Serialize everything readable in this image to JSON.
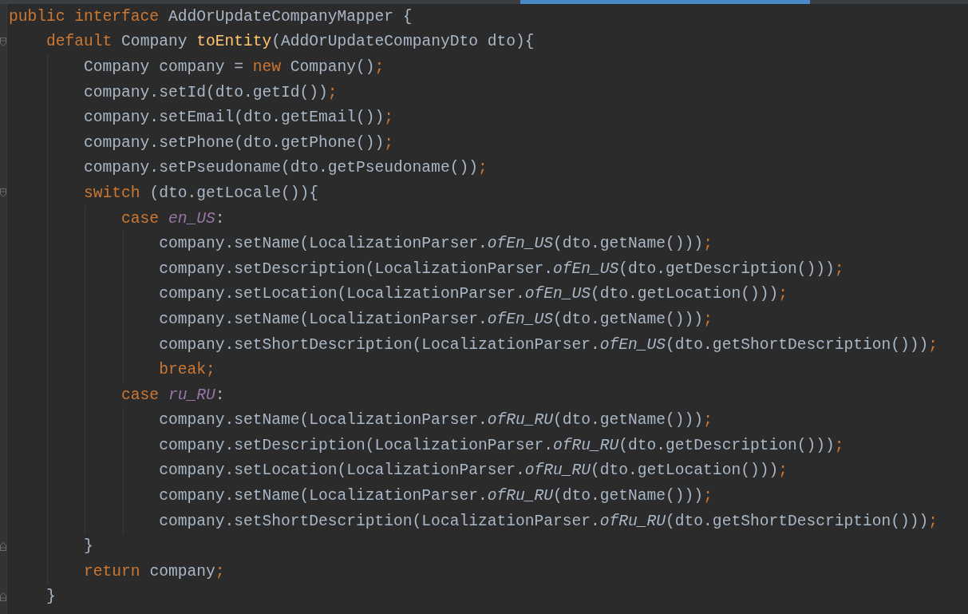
{
  "editor": {
    "lines": [
      {
        "tokens": [
          {
            "kind": "keyword",
            "text": "public interface "
          },
          {
            "kind": "plain",
            "text": "AddOrUpdateCompanyMapper {"
          }
        ]
      },
      {
        "fold_start": true,
        "tokens": [
          {
            "kind": "keyword",
            "text": "    default "
          },
          {
            "kind": "plain",
            "text": "Company "
          },
          {
            "kind": "declaration",
            "text": "toEntity"
          },
          {
            "kind": "plain",
            "text": "(AddOrUpdateCompanyDto dto){"
          }
        ]
      },
      {
        "tokens": [
          {
            "kind": "plain",
            "text": "        Company company = "
          },
          {
            "kind": "keyword",
            "text": "new "
          },
          {
            "kind": "plain",
            "text": "Company()"
          },
          {
            "kind": "keyword",
            "text": ";"
          }
        ]
      },
      {
        "tokens": [
          {
            "kind": "plain",
            "text": "        company.setId(dto.getId())"
          },
          {
            "kind": "keyword",
            "text": ";"
          }
        ]
      },
      {
        "tokens": [
          {
            "kind": "plain",
            "text": "        company.setEmail(dto.getEmail())"
          },
          {
            "kind": "keyword",
            "text": ";"
          }
        ]
      },
      {
        "tokens": [
          {
            "kind": "plain",
            "text": "        company.setPhone(dto.getPhone())"
          },
          {
            "kind": "keyword",
            "text": ";"
          }
        ]
      },
      {
        "tokens": [
          {
            "kind": "plain",
            "text": "        company.setPseudoname(dto.getPseudoname())"
          },
          {
            "kind": "keyword",
            "text": ";"
          }
        ]
      },
      {
        "fold_start": true,
        "tokens": [
          {
            "kind": "keyword",
            "text": "        switch "
          },
          {
            "kind": "plain",
            "text": "(dto.getLocale()){"
          }
        ]
      },
      {
        "tokens": [
          {
            "kind": "keyword",
            "text": "            case "
          },
          {
            "kind": "constant",
            "text": "en_US"
          },
          {
            "kind": "plain",
            "text": ":"
          }
        ]
      },
      {
        "tokens": [
          {
            "kind": "plain",
            "text": "                company.setName(LocalizationParser."
          },
          {
            "kind": "static",
            "text": "ofEn_US"
          },
          {
            "kind": "plain",
            "text": "(dto.getName()))"
          },
          {
            "kind": "keyword",
            "text": ";"
          }
        ]
      },
      {
        "tokens": [
          {
            "kind": "plain",
            "text": "                company.setDescription(LocalizationParser."
          },
          {
            "kind": "static",
            "text": "ofEn_US"
          },
          {
            "kind": "plain",
            "text": "(dto.getDescription()))"
          },
          {
            "kind": "keyword",
            "text": ";"
          }
        ]
      },
      {
        "tokens": [
          {
            "kind": "plain",
            "text": "                company.setLocation(LocalizationParser."
          },
          {
            "kind": "static",
            "text": "ofEn_US"
          },
          {
            "kind": "plain",
            "text": "(dto.getLocation()))"
          },
          {
            "kind": "keyword",
            "text": ";"
          }
        ]
      },
      {
        "tokens": [
          {
            "kind": "plain",
            "text": "                company.setName(LocalizationParser."
          },
          {
            "kind": "static",
            "text": "ofEn_US"
          },
          {
            "kind": "plain",
            "text": "(dto.getName()))"
          },
          {
            "kind": "keyword",
            "text": ";"
          }
        ]
      },
      {
        "tokens": [
          {
            "kind": "plain",
            "text": "                company.setShortDescription(LocalizationParser."
          },
          {
            "kind": "static",
            "text": "ofEn_US"
          },
          {
            "kind": "plain",
            "text": "(dto.getShortDescription()))"
          },
          {
            "kind": "keyword",
            "text": ";"
          }
        ]
      },
      {
        "tokens": [
          {
            "kind": "keyword",
            "text": "                break;"
          }
        ]
      },
      {
        "tokens": [
          {
            "kind": "keyword",
            "text": "            case "
          },
          {
            "kind": "constant",
            "text": "ru_RU"
          },
          {
            "kind": "plain",
            "text": ":"
          }
        ]
      },
      {
        "tokens": [
          {
            "kind": "plain",
            "text": "                company.setName(LocalizationParser."
          },
          {
            "kind": "static",
            "text": "ofRu_RU"
          },
          {
            "kind": "plain",
            "text": "(dto.getName()))"
          },
          {
            "kind": "keyword",
            "text": ";"
          }
        ]
      },
      {
        "tokens": [
          {
            "kind": "plain",
            "text": "                company.setDescription(LocalizationParser."
          },
          {
            "kind": "static",
            "text": "ofRu_RU"
          },
          {
            "kind": "plain",
            "text": "(dto.getDescription()))"
          },
          {
            "kind": "keyword",
            "text": ";"
          }
        ]
      },
      {
        "tokens": [
          {
            "kind": "plain",
            "text": "                company.setLocation(LocalizationParser."
          },
          {
            "kind": "static",
            "text": "ofRu_RU"
          },
          {
            "kind": "plain",
            "text": "(dto.getLocation()))"
          },
          {
            "kind": "keyword",
            "text": ";"
          }
        ]
      },
      {
        "tokens": [
          {
            "kind": "plain",
            "text": "                company.setName(LocalizationParser."
          },
          {
            "kind": "static",
            "text": "ofRu_RU"
          },
          {
            "kind": "plain",
            "text": "(dto.getName()))"
          },
          {
            "kind": "keyword",
            "text": ";"
          }
        ]
      },
      {
        "tokens": [
          {
            "kind": "plain",
            "text": "                company.setShortDescription(LocalizationParser."
          },
          {
            "kind": "static",
            "text": "ofRu_RU"
          },
          {
            "kind": "plain",
            "text": "(dto.getShortDescription()))"
          },
          {
            "kind": "keyword",
            "text": ";"
          }
        ]
      },
      {
        "fold_end": true,
        "tokens": [
          {
            "kind": "plain",
            "text": "        }"
          }
        ]
      },
      {
        "tokens": [
          {
            "kind": "keyword",
            "text": "        return "
          },
          {
            "kind": "plain",
            "text": "company"
          },
          {
            "kind": "keyword",
            "text": ";"
          }
        ]
      },
      {
        "fold_end": true,
        "tokens": [
          {
            "kind": "plain",
            "text": "    }"
          }
        ]
      }
    ]
  }
}
